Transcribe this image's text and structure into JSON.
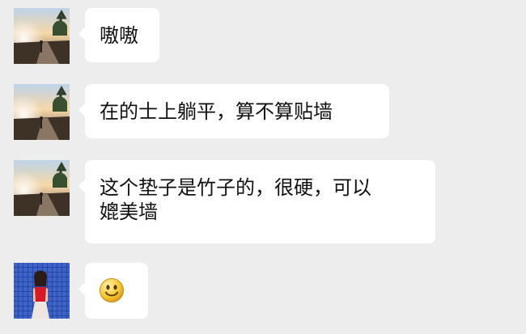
{
  "chat": {
    "messages": [
      {
        "type": "text",
        "avatar": "landscape-avatar",
        "lines": [
          "嗷嗷"
        ]
      },
      {
        "type": "text",
        "avatar": "landscape-avatar",
        "lines": [
          "在的士上躺平，算不算贴墙"
        ]
      },
      {
        "type": "text",
        "avatar": "landscape-avatar",
        "lines": [
          "这个垫子是竹子的，很硬，可以",
          "媲美墙"
        ]
      },
      {
        "type": "emoji",
        "avatar": "portrait-avatar",
        "emoji": "smile-emoji"
      }
    ]
  },
  "colors": {
    "background": "#ededed",
    "bubble": "#ffffff",
    "text": "#111111",
    "emoji": "#f6c730"
  }
}
